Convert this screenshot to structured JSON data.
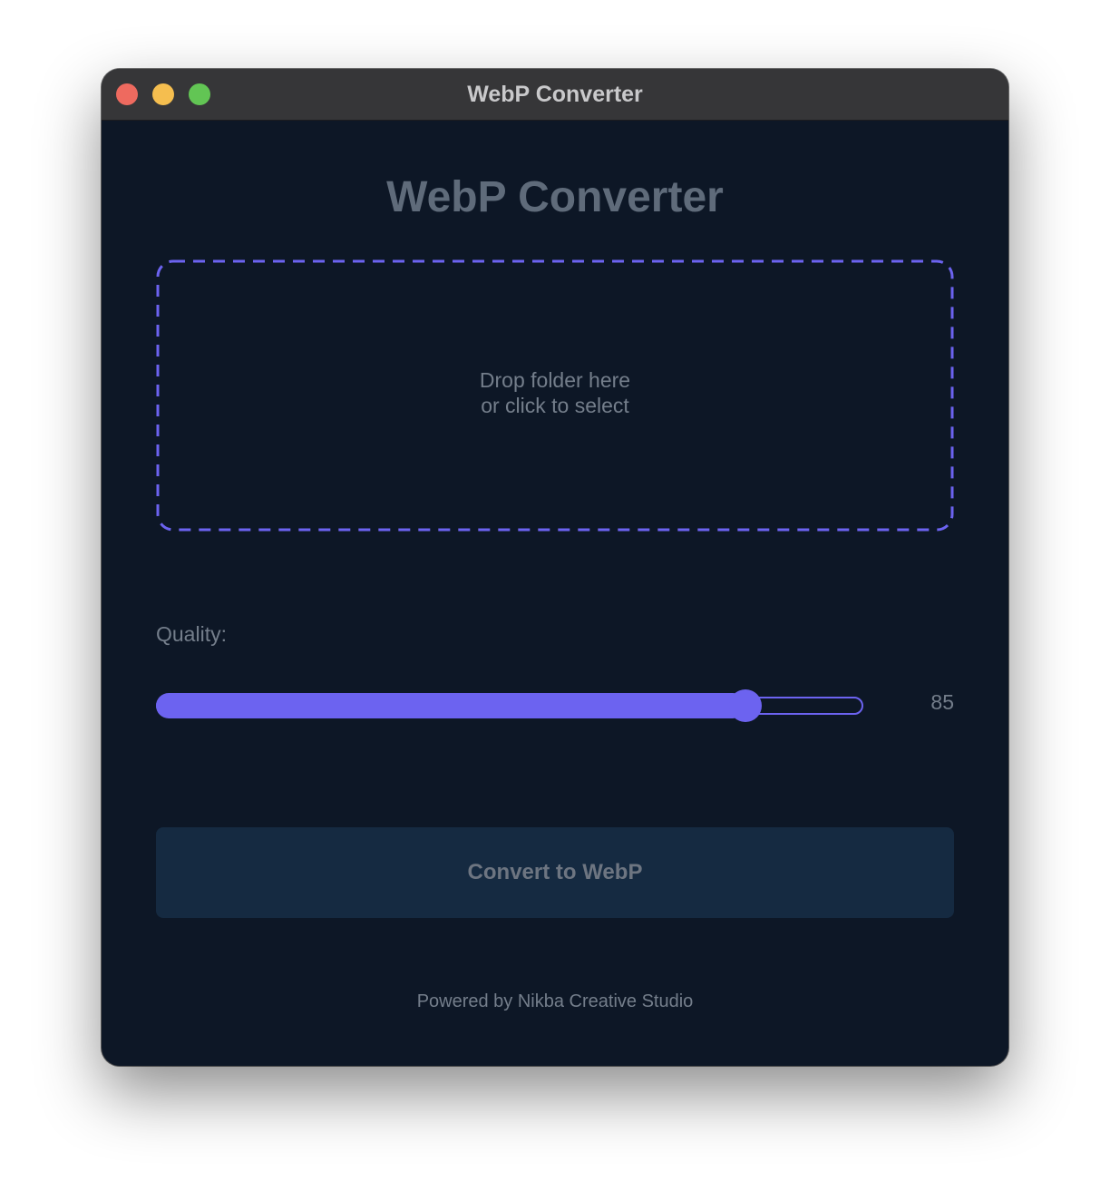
{
  "window": {
    "title": "WebP Converter"
  },
  "app": {
    "heading": "WebP Converter",
    "dropzone": {
      "line1": "Drop folder here",
      "line2": "or click to select",
      "border_color": "#6c63f0"
    },
    "quality": {
      "label": "Quality:",
      "value": 85,
      "min": 0,
      "max": 100,
      "display": "85"
    },
    "convert_button": {
      "label": "Convert to WebP"
    },
    "footer": {
      "text": "Powered by Nikba Creative Studio"
    }
  },
  "colors": {
    "background": "#0d1726",
    "accent": "#6c63f0",
    "button_bg": "#152a41",
    "muted_text": "#747e8b",
    "titlebar": "#363638",
    "traffic_close": "#ee6a5f",
    "traffic_minimize": "#f5be4f",
    "traffic_maximize": "#62c554"
  },
  "icons": {
    "close": "close-traffic-light",
    "minimize": "minimize-traffic-light",
    "maximize": "maximize-traffic-light"
  }
}
